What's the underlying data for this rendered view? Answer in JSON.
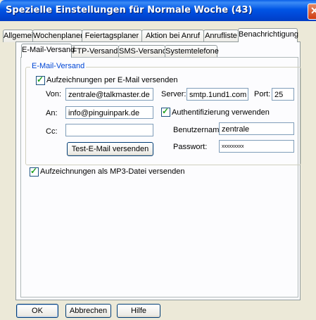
{
  "window": {
    "title": "Spezielle Einstellungen für Normale Woche (43)"
  },
  "tabs_top": [
    "Allgemein",
    "Wochenplaner",
    "Feiertagsplaner",
    "Aktion bei Anruf",
    "Anrufliste",
    "Benachrichtigung"
  ],
  "tabs_sub": [
    "E-Mail-Versand",
    "FTP-Versand",
    "SMS-Versand",
    "Systemtelefone"
  ],
  "email_group": {
    "legend": "E-Mail-Versand",
    "send_checkbox": "Aufzeichnungen per E-Mail versenden",
    "from_label": "Von:",
    "from_value": "zentrale@talkmaster.de",
    "to_label": "An:",
    "to_value": "info@pinguinpark.de",
    "cc_label": "Cc:",
    "cc_value": "",
    "server_label": "Server:",
    "server_value": "smtp.1und1.com",
    "port_label": "Port:",
    "port_value": "25",
    "auth_checkbox": "Authentifizierung verwenden",
    "username_label": "Benutzername:",
    "username_value": "zentrale",
    "password_label": "Passwort:",
    "password_value": "xxxxxxxxx",
    "test_button": "Test-E-Mail versenden"
  },
  "mp3_checkbox": "Aufzeichnungen als MP3-Datei versenden",
  "footer": {
    "ok": "OK",
    "cancel": "Abbrechen",
    "help": "Hilfe"
  }
}
